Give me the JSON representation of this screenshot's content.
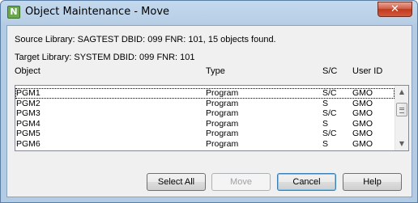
{
  "window": {
    "title": "Object Maintenance - Move",
    "app_icon_letter": "N",
    "close_symbol": "✕"
  },
  "info": {
    "source": "Source Library: SAGTEST  DBID: 099  FNR: 101, 15 objects found.",
    "target": "Target Library: SYSTEM   DBID: 099  FNR: 101"
  },
  "columns": {
    "object": "Object",
    "type": "Type",
    "sc": "S/C",
    "user": "User ID"
  },
  "rows": [
    {
      "object": "PGM1",
      "type": "Program",
      "sc": "S/C",
      "user": "GMO"
    },
    {
      "object": "PGM2",
      "type": "Program",
      "sc": "S",
      "user": "GMO"
    },
    {
      "object": "PGM3",
      "type": "Program",
      "sc": "S/C",
      "user": "GMO"
    },
    {
      "object": "PGM4",
      "type": "Program",
      "sc": "S",
      "user": "GMO"
    },
    {
      "object": "PGM5",
      "type": "Program",
      "sc": "S/C",
      "user": "GMO"
    },
    {
      "object": "PGM6",
      "type": "Program",
      "sc": "S",
      "user": "GMO"
    }
  ],
  "scrollbar": {
    "up_symbol": "▲",
    "down_symbol": "▼"
  },
  "buttons": {
    "select_all": "Select All",
    "move": "Move",
    "cancel": "Cancel",
    "help": "Help"
  }
}
